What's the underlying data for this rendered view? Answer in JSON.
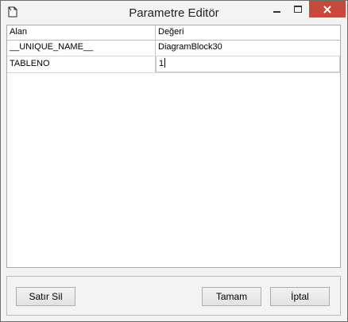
{
  "window": {
    "title": "Parametre Editör"
  },
  "icons": {
    "app": "document-icon",
    "minimize": "minimize-icon",
    "maximize": "maximize-icon",
    "close": "close-icon"
  },
  "grid": {
    "columns": [
      "Alan",
      "Değeri"
    ],
    "rows": [
      {
        "field": "__UNIQUE_NAME__",
        "value": "DiagramBlock30"
      },
      {
        "field": "TABLENO",
        "value": "1"
      }
    ]
  },
  "buttons": {
    "delete_row": "Satır Sil",
    "ok": "Tamam",
    "cancel": "İptal"
  },
  "colors": {
    "close_button": "#c7493b",
    "window_bg": "#f3f3f3",
    "grid_bg": "#ffffff"
  }
}
